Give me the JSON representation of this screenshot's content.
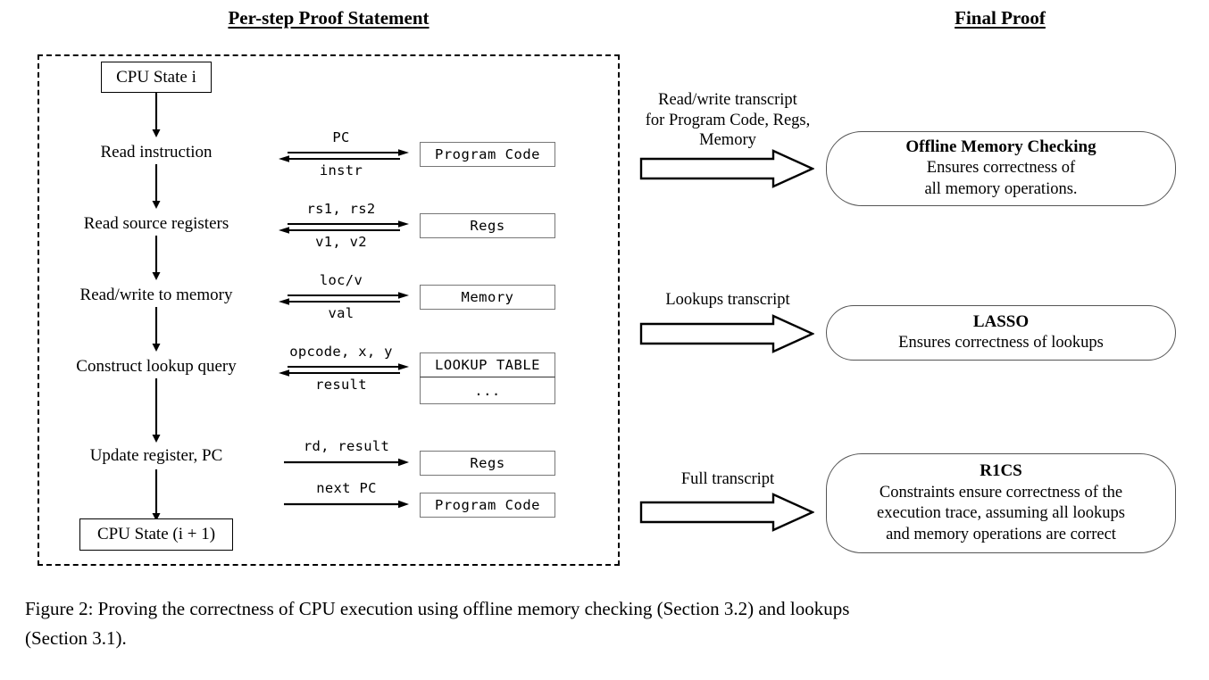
{
  "panels": {
    "left_title": "Per-step Proof Statement",
    "right_title": "Final Proof"
  },
  "flow": {
    "start_state": "CPU State i",
    "end_state": "CPU State (i + 1)",
    "steps": [
      {
        "label": "Read instruction",
        "out_msg": "PC",
        "in_msg": "instr",
        "target": "Program Code",
        "bidirectional": true
      },
      {
        "label": "Read source registers",
        "out_msg": "rs1, rs2",
        "in_msg": "v1, v2",
        "target": "Regs",
        "bidirectional": true
      },
      {
        "label": "Read/write to memory",
        "out_msg": "loc/v",
        "in_msg": "val",
        "target": "Memory",
        "bidirectional": true
      },
      {
        "label": "Construct lookup query",
        "out_msg": "opcode, x, y",
        "in_msg": "result",
        "target": "LOOKUP TABLE",
        "target_second_row": "...",
        "bidirectional": true
      },
      {
        "label": "Update register, PC",
        "out_msg": "rd, result",
        "in_msg": "",
        "target": "Regs",
        "bidirectional": false
      },
      {
        "label": "",
        "out_msg": "next PC",
        "in_msg": "",
        "target": "Program Code",
        "bidirectional": false
      }
    ]
  },
  "final_proof": {
    "items": [
      {
        "transcript": "Read/write transcript\nfor Program Code, Regs,\nMemory",
        "transcript_lines": [
          "Read/write transcript",
          "for Program Code, Regs,",
          "Memory"
        ],
        "title": "Offline Memory Checking",
        "desc_lines": [
          "Ensures correctness of",
          "all memory operations."
        ]
      },
      {
        "transcript": "Lookups transcript",
        "transcript_lines": [
          "Lookups transcript"
        ],
        "title": "LASSO",
        "desc_lines": [
          "Ensures correctness of lookups"
        ]
      },
      {
        "transcript": "Full transcript",
        "transcript_lines": [
          "Full transcript"
        ],
        "title": "R1CS",
        "desc_lines": [
          "Constraints ensure correctness of the",
          "execution trace, assuming all lookups",
          "and memory operations are correct"
        ]
      }
    ]
  },
  "caption": {
    "line1": "Figure 2: Proving the correctness of CPU execution using offline memory checking (Section 3.2) and lookups",
    "line2": "(Section 3.1)."
  },
  "colors": {
    "ink": "#000000",
    "page": "#ffffff",
    "box_border": "#777777",
    "proof_border": "#555555"
  }
}
